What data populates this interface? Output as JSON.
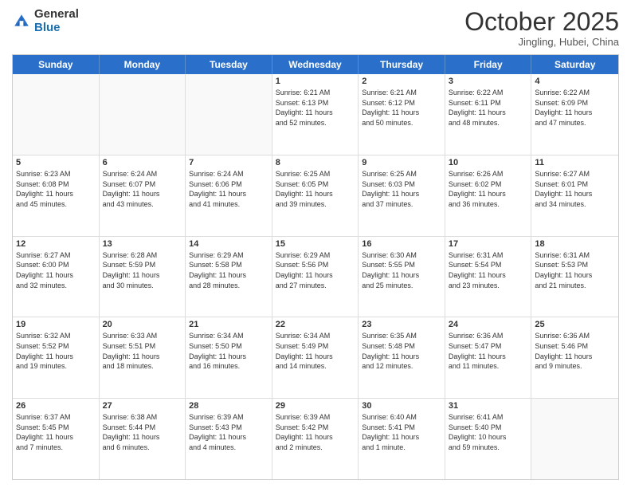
{
  "logo": {
    "general": "General",
    "blue": "Blue"
  },
  "header": {
    "month": "October 2025",
    "location": "Jingling, Hubei, China"
  },
  "weekdays": [
    "Sunday",
    "Monday",
    "Tuesday",
    "Wednesday",
    "Thursday",
    "Friday",
    "Saturday"
  ],
  "weeks": [
    [
      {
        "day": "",
        "text": ""
      },
      {
        "day": "",
        "text": ""
      },
      {
        "day": "",
        "text": ""
      },
      {
        "day": "1",
        "text": "Sunrise: 6:21 AM\nSunset: 6:13 PM\nDaylight: 11 hours\nand 52 minutes."
      },
      {
        "day": "2",
        "text": "Sunrise: 6:21 AM\nSunset: 6:12 PM\nDaylight: 11 hours\nand 50 minutes."
      },
      {
        "day": "3",
        "text": "Sunrise: 6:22 AM\nSunset: 6:11 PM\nDaylight: 11 hours\nand 48 minutes."
      },
      {
        "day": "4",
        "text": "Sunrise: 6:22 AM\nSunset: 6:09 PM\nDaylight: 11 hours\nand 47 minutes."
      }
    ],
    [
      {
        "day": "5",
        "text": "Sunrise: 6:23 AM\nSunset: 6:08 PM\nDaylight: 11 hours\nand 45 minutes."
      },
      {
        "day": "6",
        "text": "Sunrise: 6:24 AM\nSunset: 6:07 PM\nDaylight: 11 hours\nand 43 minutes."
      },
      {
        "day": "7",
        "text": "Sunrise: 6:24 AM\nSunset: 6:06 PM\nDaylight: 11 hours\nand 41 minutes."
      },
      {
        "day": "8",
        "text": "Sunrise: 6:25 AM\nSunset: 6:05 PM\nDaylight: 11 hours\nand 39 minutes."
      },
      {
        "day": "9",
        "text": "Sunrise: 6:25 AM\nSunset: 6:03 PM\nDaylight: 11 hours\nand 37 minutes."
      },
      {
        "day": "10",
        "text": "Sunrise: 6:26 AM\nSunset: 6:02 PM\nDaylight: 11 hours\nand 36 minutes."
      },
      {
        "day": "11",
        "text": "Sunrise: 6:27 AM\nSunset: 6:01 PM\nDaylight: 11 hours\nand 34 minutes."
      }
    ],
    [
      {
        "day": "12",
        "text": "Sunrise: 6:27 AM\nSunset: 6:00 PM\nDaylight: 11 hours\nand 32 minutes."
      },
      {
        "day": "13",
        "text": "Sunrise: 6:28 AM\nSunset: 5:59 PM\nDaylight: 11 hours\nand 30 minutes."
      },
      {
        "day": "14",
        "text": "Sunrise: 6:29 AM\nSunset: 5:58 PM\nDaylight: 11 hours\nand 28 minutes."
      },
      {
        "day": "15",
        "text": "Sunrise: 6:29 AM\nSunset: 5:56 PM\nDaylight: 11 hours\nand 27 minutes."
      },
      {
        "day": "16",
        "text": "Sunrise: 6:30 AM\nSunset: 5:55 PM\nDaylight: 11 hours\nand 25 minutes."
      },
      {
        "day": "17",
        "text": "Sunrise: 6:31 AM\nSunset: 5:54 PM\nDaylight: 11 hours\nand 23 minutes."
      },
      {
        "day": "18",
        "text": "Sunrise: 6:31 AM\nSunset: 5:53 PM\nDaylight: 11 hours\nand 21 minutes."
      }
    ],
    [
      {
        "day": "19",
        "text": "Sunrise: 6:32 AM\nSunset: 5:52 PM\nDaylight: 11 hours\nand 19 minutes."
      },
      {
        "day": "20",
        "text": "Sunrise: 6:33 AM\nSunset: 5:51 PM\nDaylight: 11 hours\nand 18 minutes."
      },
      {
        "day": "21",
        "text": "Sunrise: 6:34 AM\nSunset: 5:50 PM\nDaylight: 11 hours\nand 16 minutes."
      },
      {
        "day": "22",
        "text": "Sunrise: 6:34 AM\nSunset: 5:49 PM\nDaylight: 11 hours\nand 14 minutes."
      },
      {
        "day": "23",
        "text": "Sunrise: 6:35 AM\nSunset: 5:48 PM\nDaylight: 11 hours\nand 12 minutes."
      },
      {
        "day": "24",
        "text": "Sunrise: 6:36 AM\nSunset: 5:47 PM\nDaylight: 11 hours\nand 11 minutes."
      },
      {
        "day": "25",
        "text": "Sunrise: 6:36 AM\nSunset: 5:46 PM\nDaylight: 11 hours\nand 9 minutes."
      }
    ],
    [
      {
        "day": "26",
        "text": "Sunrise: 6:37 AM\nSunset: 5:45 PM\nDaylight: 11 hours\nand 7 minutes."
      },
      {
        "day": "27",
        "text": "Sunrise: 6:38 AM\nSunset: 5:44 PM\nDaylight: 11 hours\nand 6 minutes."
      },
      {
        "day": "28",
        "text": "Sunrise: 6:39 AM\nSunset: 5:43 PM\nDaylight: 11 hours\nand 4 minutes."
      },
      {
        "day": "29",
        "text": "Sunrise: 6:39 AM\nSunset: 5:42 PM\nDaylight: 11 hours\nand 2 minutes."
      },
      {
        "day": "30",
        "text": "Sunrise: 6:40 AM\nSunset: 5:41 PM\nDaylight: 11 hours\nand 1 minute."
      },
      {
        "day": "31",
        "text": "Sunrise: 6:41 AM\nSunset: 5:40 PM\nDaylight: 10 hours\nand 59 minutes."
      },
      {
        "day": "",
        "text": ""
      }
    ]
  ]
}
